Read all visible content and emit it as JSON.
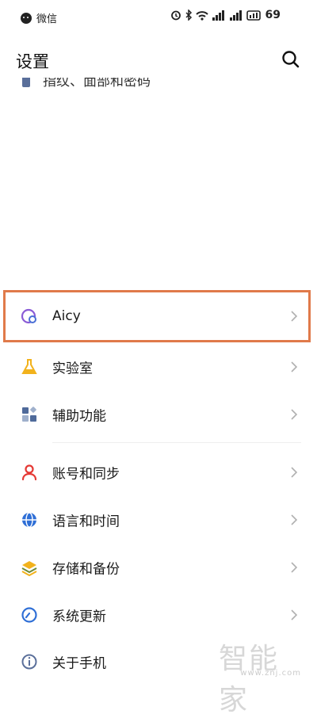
{
  "status_bar": {
    "app_label": "微信",
    "battery": "69"
  },
  "header": {
    "title": "设置"
  },
  "clipped_item": {
    "label": "指纹、面部和密码"
  },
  "settings": {
    "items": [
      {
        "label": "Aicy",
        "icon": "aicy-icon",
        "color": "#8a5cd6"
      },
      {
        "label": "实验室",
        "icon": "flask-icon",
        "color": "#f2b21c"
      },
      {
        "label": "辅助功能",
        "icon": "accessibility-grid-icon",
        "color": "#4f6a9a"
      },
      {
        "label": "账号和同步",
        "icon": "person-icon",
        "color": "#e53935"
      },
      {
        "label": "语言和时间",
        "icon": "globe-icon",
        "color": "#2f6fd6"
      },
      {
        "label": "存储和备份",
        "icon": "layers-icon",
        "color": "#f2b21c"
      },
      {
        "label": "系统更新",
        "icon": "update-icon",
        "color": "#2f6fd6"
      },
      {
        "label": "关于手机",
        "icon": "info-icon",
        "color": "#5a6f9a"
      }
    ]
  },
  "highlight_color": "#e07a4a",
  "watermark": {
    "main": "智能家",
    "sub": "www.znj.com"
  }
}
